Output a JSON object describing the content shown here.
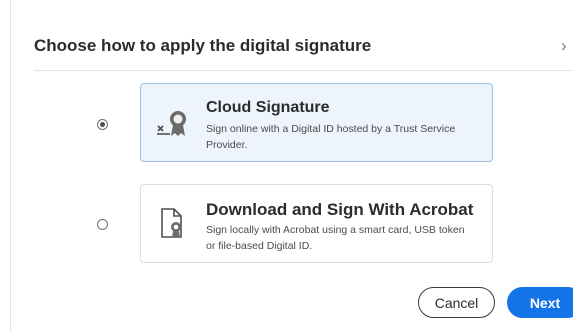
{
  "dialog": {
    "title": "Choose how to apply the digital signature",
    "chevron": "›"
  },
  "options": [
    {
      "title": "Cloud Signature",
      "description": "Sign online with a Digital ID hosted by a Trust Service Provider.",
      "selected": true,
      "icon": "cloud-signature-icon"
    },
    {
      "title": "Download and Sign With Acrobat",
      "description": "Sign locally with Acrobat using a smart card, USB token or file-based Digital ID.",
      "selected": false,
      "icon": "document-certificate-icon"
    }
  ],
  "footer": {
    "cancel_label": "Cancel",
    "next_label": "Next"
  },
  "colors": {
    "accent": "#1473e6",
    "selected_card_bg": "#eef4fb",
    "selected_card_border": "#9bc0e9"
  }
}
